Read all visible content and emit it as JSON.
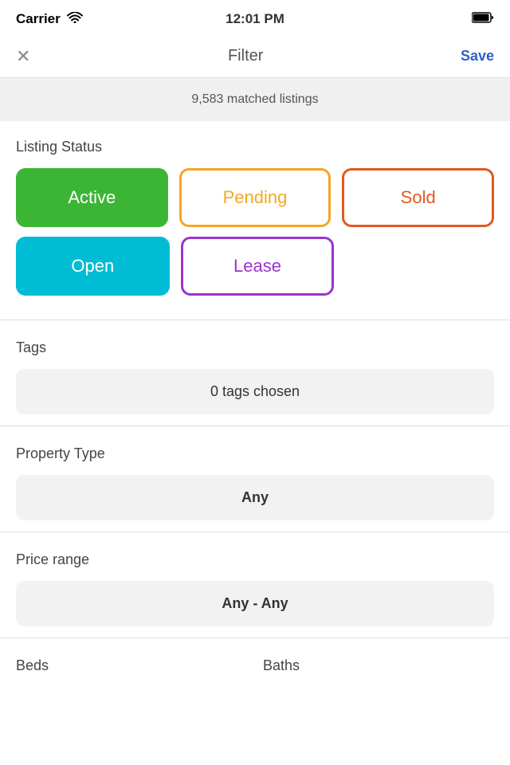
{
  "statusBar": {
    "carrier": "Carrier",
    "wifi": "📶",
    "time": "12:01 PM",
    "battery": "🔋"
  },
  "nav": {
    "close": "✕",
    "title": "Filter",
    "save": "Save"
  },
  "matchedBanner": "9,583 matched listings",
  "listingStatus": {
    "label": "Listing Status",
    "buttons": {
      "active": "Active",
      "pending": "Pending",
      "sold": "Sold",
      "open": "Open",
      "lease": "Lease"
    }
  },
  "tags": {
    "label": "Tags",
    "button": "0 tags chosen"
  },
  "propertyType": {
    "label": "Property Type",
    "button": "Any"
  },
  "priceRange": {
    "label": "Price range",
    "button": "Any - Any"
  },
  "bedsLabel": "Beds",
  "bathsLabel": "Baths"
}
